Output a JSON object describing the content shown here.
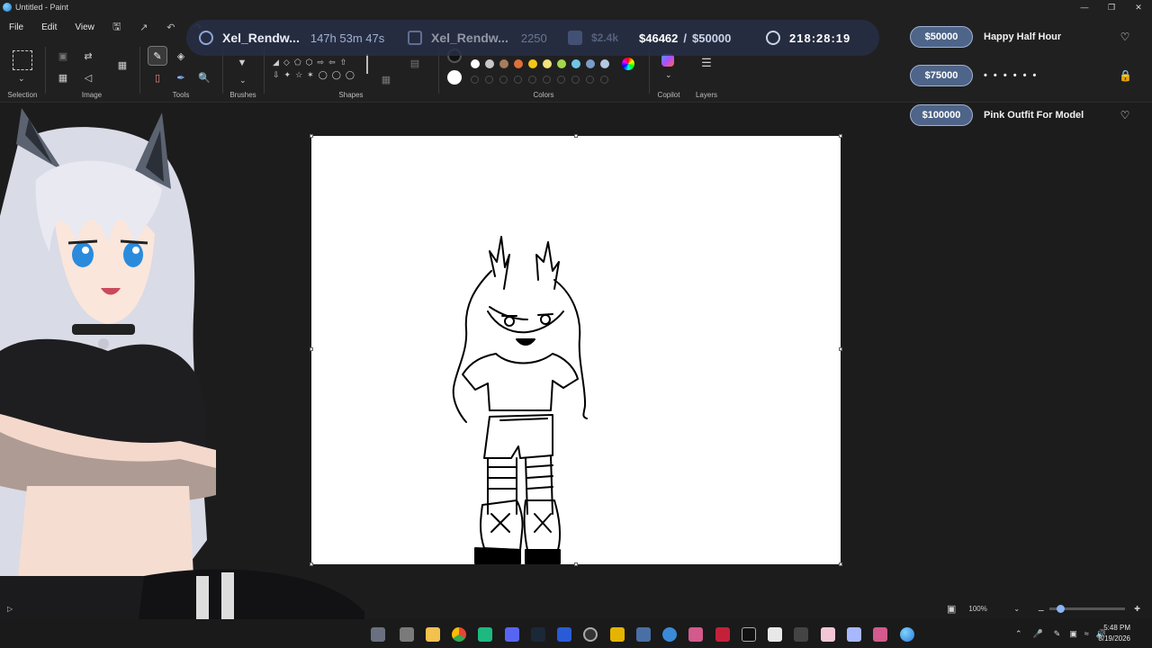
{
  "window": {
    "title": "Untitled - Paint"
  },
  "menu": {
    "file": "File",
    "edit": "Edit",
    "view": "View"
  },
  "ribbon": {
    "groups": {
      "selection": "Selection",
      "image": "Image",
      "tools": "Tools",
      "brushes": "Brushes",
      "shapes": "Shapes",
      "colors": "Colors",
      "copilot": "Copilot",
      "layers": "Layers"
    },
    "palette": [
      "#ffffff",
      "#c8c8c8",
      "#a67c5b",
      "#e0703a",
      "#f5c518",
      "#f2e37a",
      "#a5d84a",
      "#6fc5e6",
      "#7a9cc6",
      "#b7c9e2"
    ]
  },
  "stream_overlay": {
    "follower_name": "Xel_Rendw...",
    "follower_time": "147h 53m 47s",
    "sub_name": "Xel_Rendw...",
    "sub_count": "2250",
    "bits": "$2.4k",
    "goal_current": "$46462",
    "goal_separator": "/",
    "goal_target": "$50000",
    "timer": "218:28:19"
  },
  "goals": [
    {
      "amount": "$50000",
      "label": "Happy Half Hour",
      "icon": "heart-icon"
    },
    {
      "amount": "$75000",
      "label": "• • • • • •",
      "icon": "lock-icon"
    },
    {
      "amount": "$100000",
      "label": "Pink Outfit For Model",
      "icon": "heart-icon"
    }
  ],
  "status": {
    "zoom": "100%"
  },
  "clock": {
    "time": "5:48 PM",
    "date": "8/19/2026"
  }
}
